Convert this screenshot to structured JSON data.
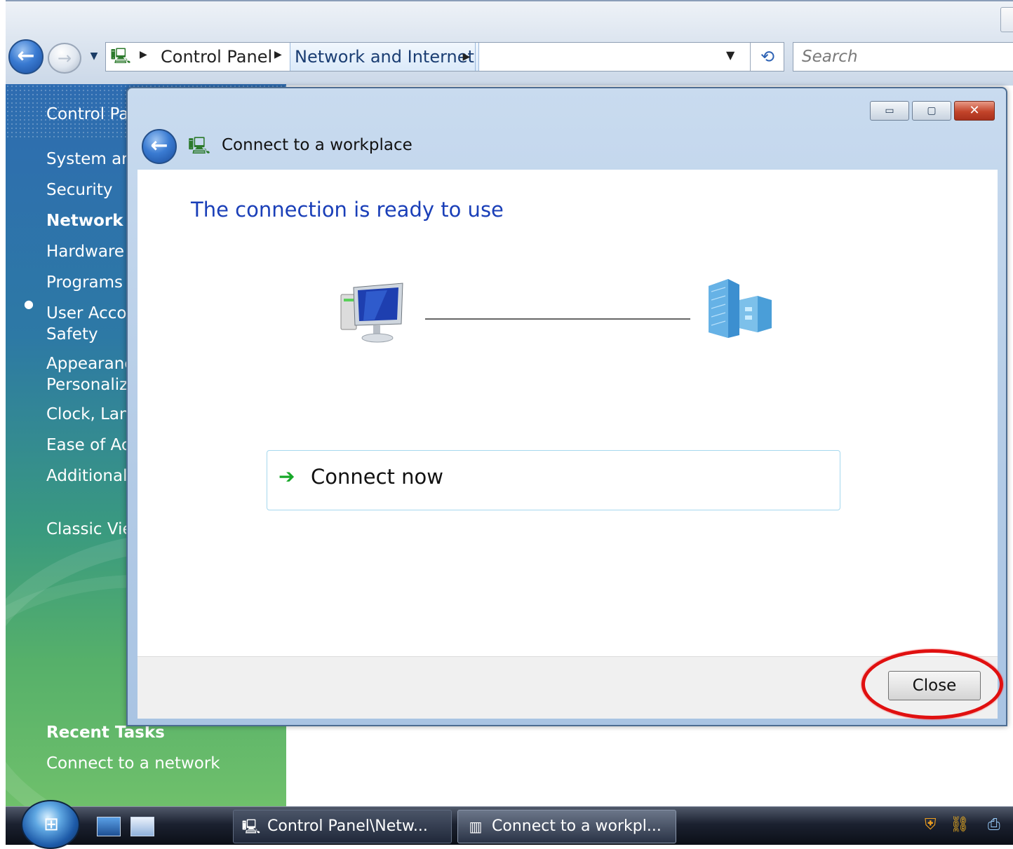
{
  "address_bar": {
    "segments": [
      "Control Panel",
      "Network and Internet"
    ],
    "search_placeholder": "Search"
  },
  "left_pane": {
    "items": [
      {
        "label": "Control Pa"
      },
      {
        "label": "System and"
      },
      {
        "label": "Security"
      },
      {
        "label": "Network a"
      },
      {
        "label": "Hardware a"
      },
      {
        "label": "Programs"
      },
      {
        "label": "User Accou"
      },
      {
        "label": "Safety"
      },
      {
        "label": "Appearanc"
      },
      {
        "label": "Personaliza"
      },
      {
        "label": "Clock, Lang"
      },
      {
        "label": "Ease of Acc"
      },
      {
        "label": "Additional"
      },
      {
        "label": "Classic Vie"
      }
    ],
    "recent_tasks_heading": "Recent Tasks",
    "recent_task": "Connect to a network"
  },
  "dialog": {
    "title": "Connect to a workplace",
    "heading": "The connection is ready to use",
    "connect_now_label": "Connect now",
    "close_label": "Close",
    "close_icon_glyph": "✕",
    "minimize_glyph": "▭",
    "maximize_glyph": "▢"
  },
  "taskbar": {
    "tasks": [
      {
        "label": "Control Panel\\Netw..."
      },
      {
        "label": "Connect to a workpl..."
      }
    ]
  },
  "colors": {
    "heading_blue": "#1a3fb8",
    "connect_arrow_green": "#17a829",
    "highlight_red": "#e01010"
  }
}
